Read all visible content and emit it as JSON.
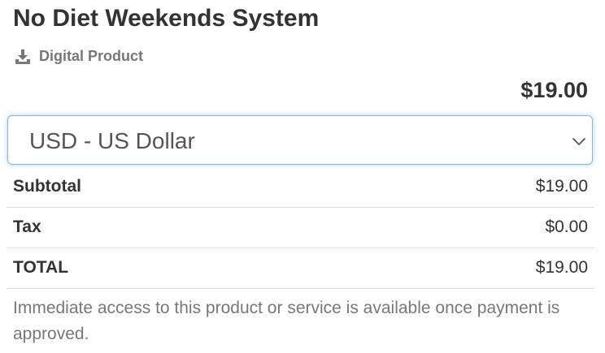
{
  "product": {
    "title": "No Diet Weekends System",
    "type_label": "Digital Product",
    "type_icon": "download-icon",
    "price": "$19.00"
  },
  "currency": {
    "selected": "USD - US Dollar",
    "dropdown_icon": "chevron-down-icon",
    "focus_color": "#66afe9"
  },
  "totals": {
    "subtotal_label": "Subtotal",
    "subtotal_value": "$19.00",
    "tax_label": "Tax",
    "tax_value": "$0.00",
    "total_label": "TOTAL",
    "total_value": "$19.00"
  },
  "notice": "Immediate access to this product or service is available once payment is approved."
}
